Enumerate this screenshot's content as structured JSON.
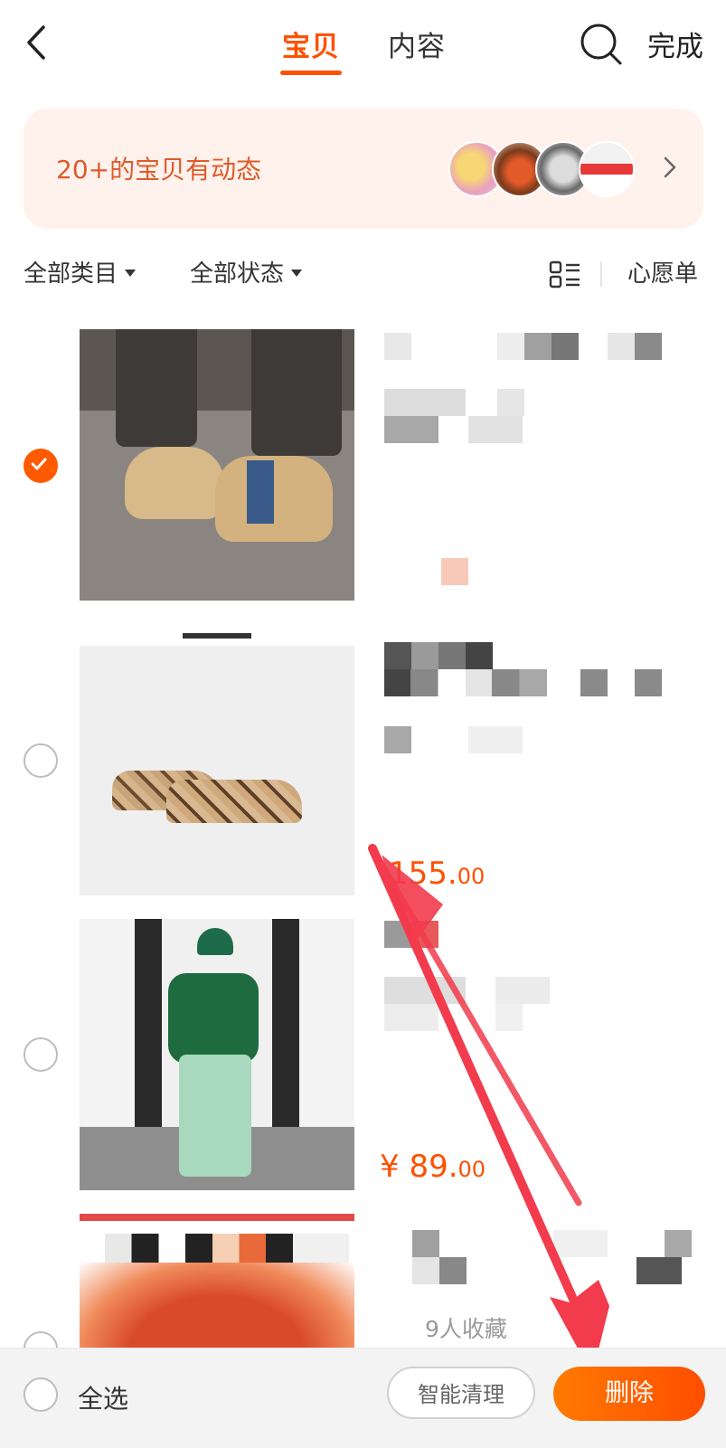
{
  "header": {
    "tabs": [
      {
        "label": "宝贝",
        "active": true
      },
      {
        "label": "内容",
        "active": false
      }
    ],
    "done_label": "完成"
  },
  "banner": {
    "text": "20+的宝贝有动态"
  },
  "filters": {
    "category": "全部类目",
    "status": "全部状态",
    "wishlist": "心愿单"
  },
  "items": [
    {
      "selected": true,
      "price": "",
      "price_cents": "",
      "fav": ""
    },
    {
      "selected": false,
      "price": "155.",
      "price_cents": "00",
      "fav": ""
    },
    {
      "selected": false,
      "price": "¥ 89.",
      "price_cents": "00",
      "fav": ""
    },
    {
      "selected": false,
      "price": "",
      "price_cents": "",
      "fav": "9人收藏"
    }
  ],
  "bottom_bar": {
    "select_all": "全选",
    "smart_clean": "智能清理",
    "delete": "删除"
  },
  "colors": {
    "accent": "#ff5000",
    "banner_bg": "#fff2ed",
    "annotation_arrow": "#f23b4c"
  }
}
